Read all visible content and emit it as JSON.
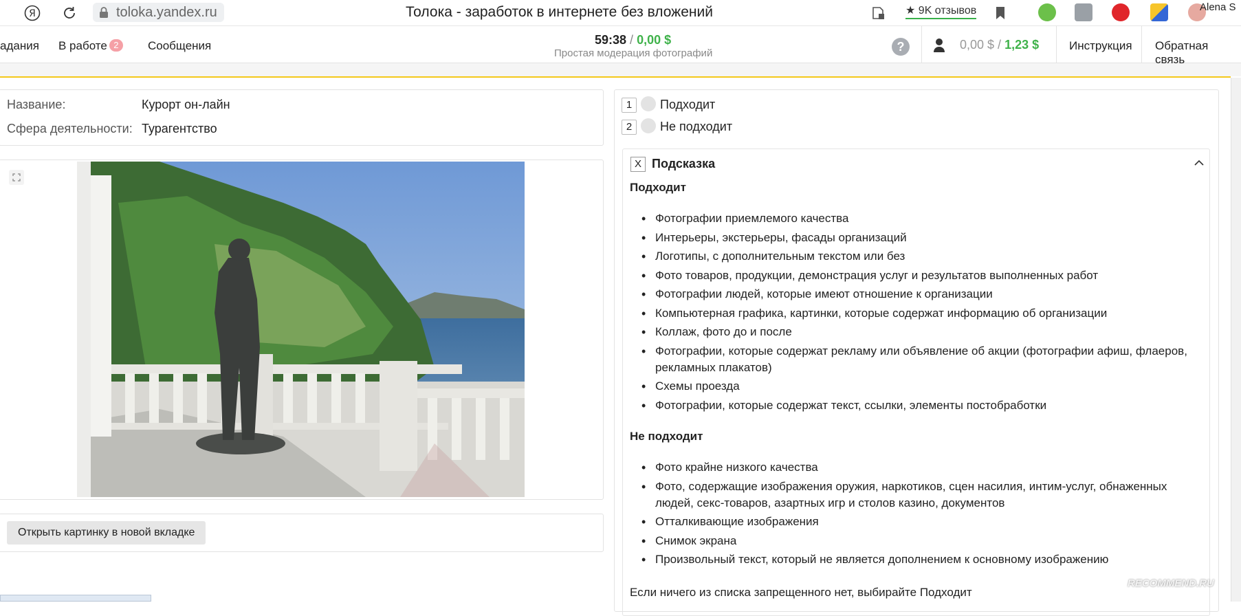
{
  "browser": {
    "yandex_logo": "Я",
    "url": "toloka.yandex.ru",
    "title": "Толока - заработок в интернете без вложений",
    "reviews_label": "★ 9K отзывов",
    "profile_name": "Alena S"
  },
  "app_header": {
    "nav": [
      {
        "label": "адания"
      },
      {
        "label": "В работе",
        "badge": "2"
      },
      {
        "label": "Сообщения"
      }
    ],
    "timer": "59:38",
    "timer_sep": " / ",
    "earned": "0,00 $",
    "task_name": "Простая модерация фотографий",
    "help_label": "?",
    "balance_pending": "0,00 $",
    "balance_sep": " / ",
    "balance_available": "1,23 $",
    "instruction_label": "Инструкция",
    "feedback_label": "Обратная связь"
  },
  "info": {
    "name_label": "Название:",
    "name_value": "Курорт он-лайн",
    "sphere_label": "Сфера деятельности:",
    "sphere_value": "Турагентство"
  },
  "open_image_label": "Открыть картинку в новой вкладке",
  "choices": [
    {
      "key": "1",
      "label": "Подходит"
    },
    {
      "key": "2",
      "label": "Не подходит"
    }
  ],
  "hint": {
    "close_label": "X",
    "title": "Подсказка",
    "good_title": "Подходит",
    "good_items": [
      "Фотографии приемлемого качества",
      "Интерьеры, экстерьеры, фасады организаций",
      "Логотипы, с дополнительным текстом или без",
      "Фото товаров, продукции, демонстрация услуг и результатов выполненных работ",
      "Фотографии людей, которые имеют отношение к организации",
      "Компьютерная графика, картинки, которые содержат информацию об организации",
      "Коллаж, фото до и после",
      "Фотографии, которые содержат рекламу или объявление об акции (фотографии афиш, флаеров, рекламных плакатов)",
      "Схемы проезда",
      "Фотографии, которые содержат текст, ссылки, элементы постобработки"
    ],
    "bad_title": "Не подходит",
    "bad_items": [
      "Фото крайне низкого качества",
      "Фото, содержащие изображения оружия, наркотиков, сцен насилия, интим-услуг, обнаженных людей, секс-товаров, азартных игр и столов казино, документов",
      "Отталкивающие изображения",
      "Снимок экрана",
      "Произвольный текст, который не является дополнением к основному изображению"
    ],
    "footer": "Если ничего из списка запрещенного нет, выбирайте Подходит"
  },
  "watermark": "RECOMMEND.RU",
  "colors": {
    "accent_green": "#3fb24a",
    "accent_yellow": "#f4c81a",
    "badge_pink": "#f5a0a6"
  }
}
